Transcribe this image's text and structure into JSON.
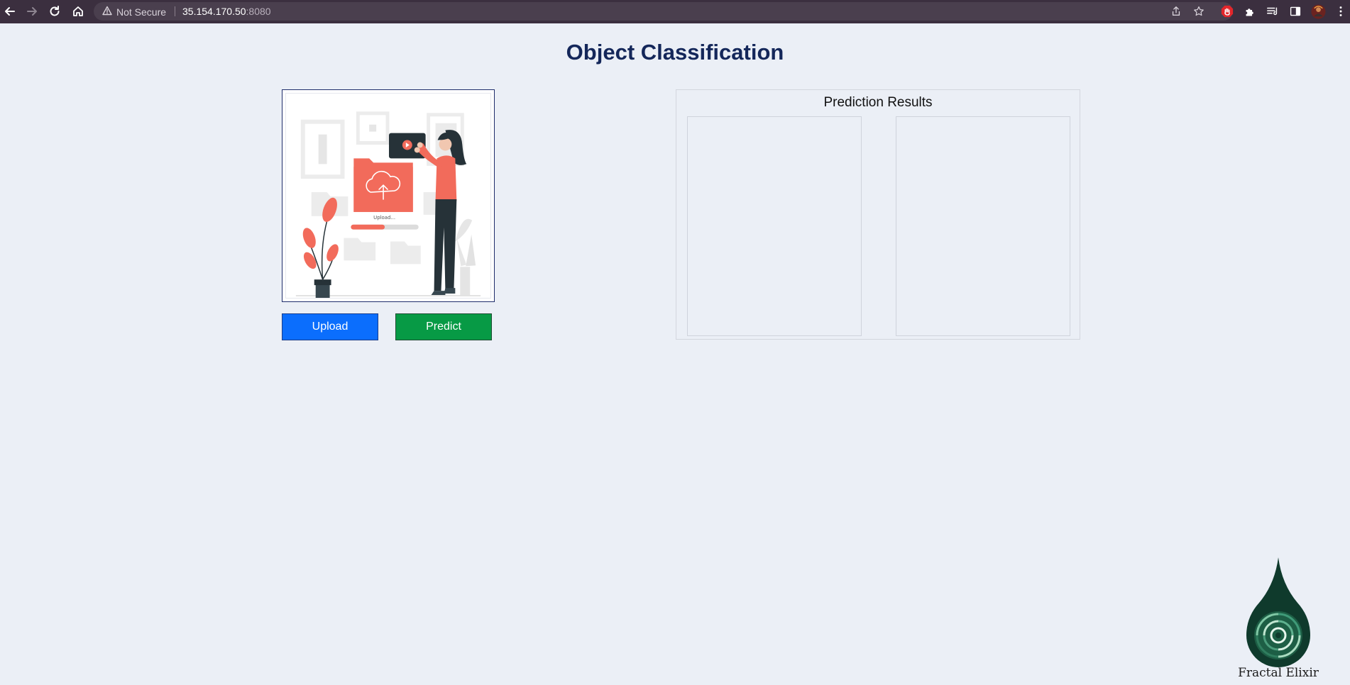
{
  "browser": {
    "security_label": "Not Secure",
    "url_host": "35.154.170.50",
    "url_port": ":8080",
    "icons": [
      "back-arrow-icon",
      "forward-arrow-icon",
      "reload-icon",
      "home-icon",
      "warning-triangle-icon",
      "share-icon",
      "star-icon",
      "adblock-hand-icon",
      "puzzle-extensions-icon",
      "reading-list-icon",
      "side-panel-icon",
      "profile-avatar-icon",
      "more-menu-icon"
    ]
  },
  "page": {
    "title": "Object Classification",
    "upload_button": "Upload",
    "predict_button": "Predict",
    "results_title": "Prediction Results",
    "illustration_text": "Upload...",
    "logo_text": "Fractal Elixir"
  },
  "colors": {
    "background": "#ebeff6",
    "title": "#14275a",
    "upload_button": "#0b6efd",
    "predict_button": "#079a45",
    "illustration_accent": "#f26b5b"
  }
}
